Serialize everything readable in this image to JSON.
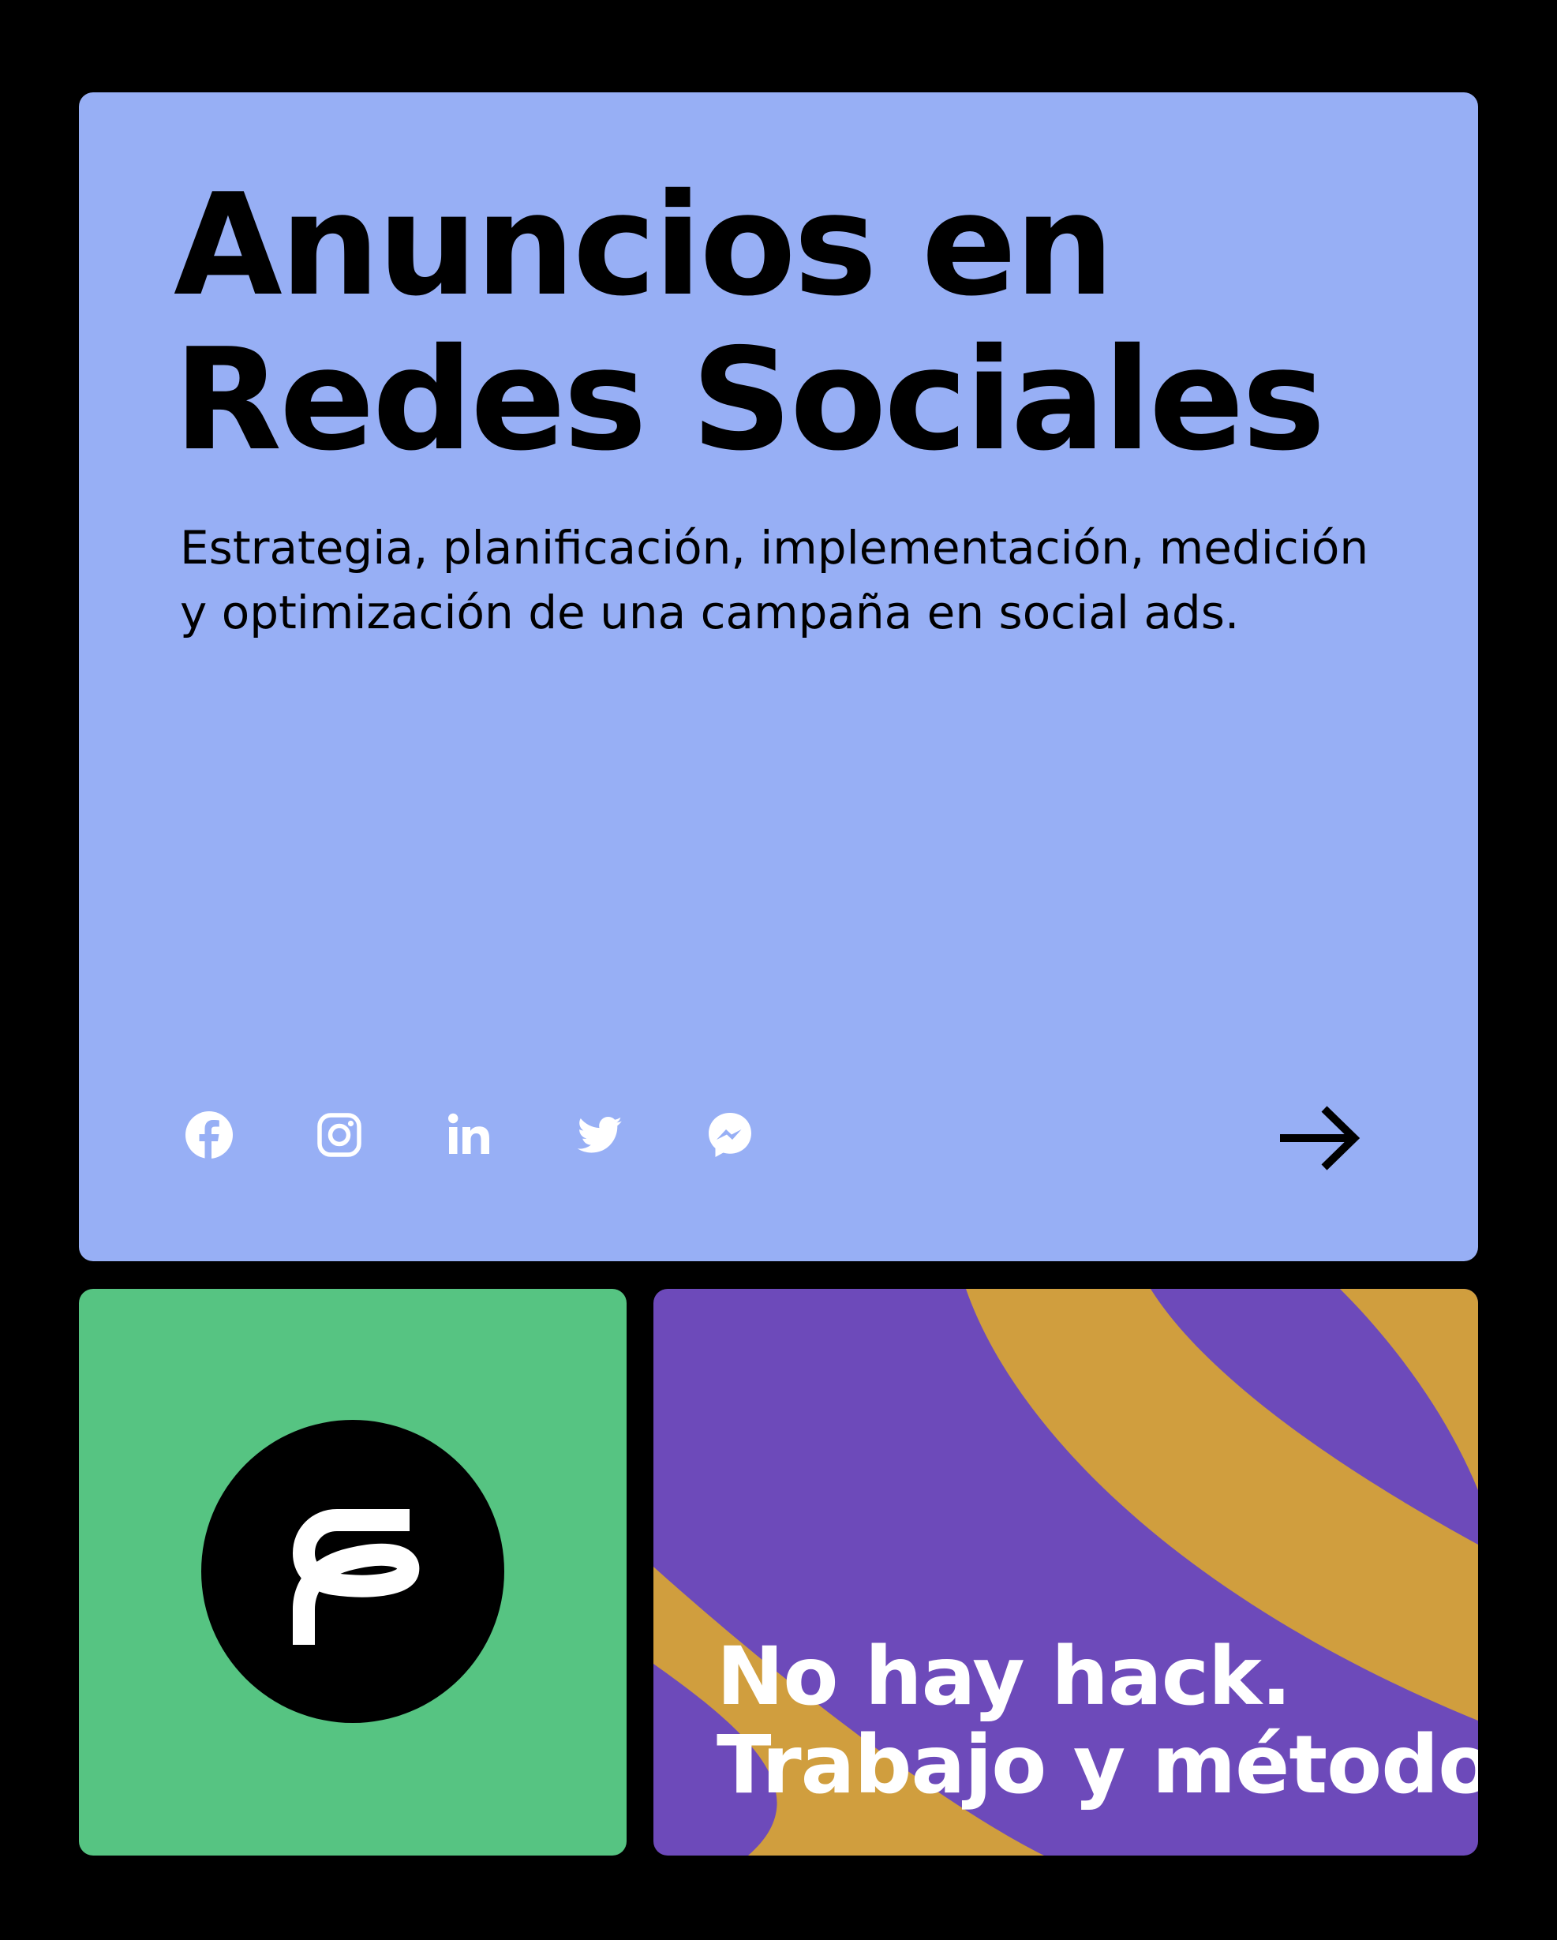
{
  "hero": {
    "title_line1": "Anuncios en",
    "title_line2": "Redes Sociales",
    "subtitle_line1": "Estrategia, planificación, implementación, medición",
    "subtitle_line2": "y optimización de una campaña en social ads.",
    "background": "#97aff5",
    "social_icons": [
      "facebook-icon",
      "instagram-icon",
      "linkedin-icon",
      "twitter-icon",
      "messenger-icon"
    ],
    "arrow_icon": "arrow-right-icon"
  },
  "logo_card": {
    "background": "#56c482",
    "logo": "brand-logo-icon"
  },
  "tagline_card": {
    "line1": "No hay hack.",
    "line2": "Trabajo y método",
    "background": "#6d4aba",
    "stripe_color": "#d09e3e"
  }
}
